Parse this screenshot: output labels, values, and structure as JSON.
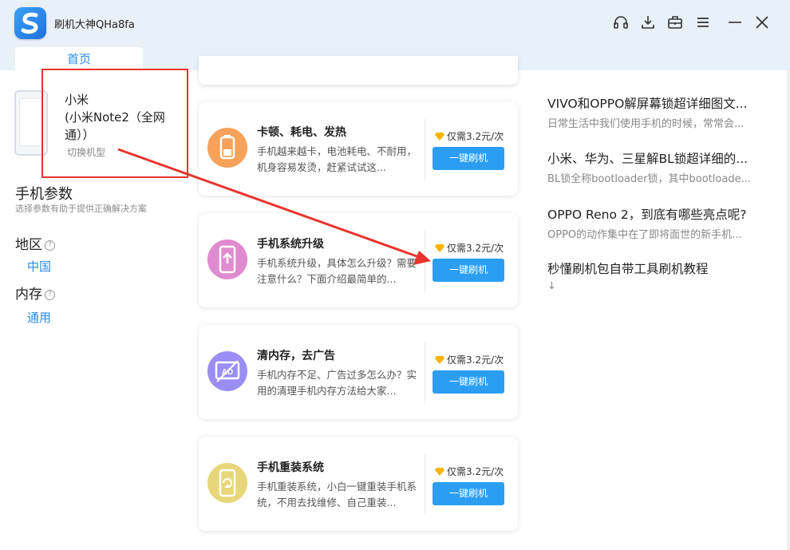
{
  "app": {
    "title": "刷机大神QHa8fa",
    "tab_home": "首页"
  },
  "device": {
    "brand": "小米",
    "model": "(小米Note2（全网通））",
    "switch_label": "切换机型"
  },
  "params": {
    "title": "手机参数",
    "subtitle": "选择参数有助于提供正确解决方案",
    "region_label": "地区",
    "region_value": "中国",
    "memory_label": "内存",
    "memory_value": "通用",
    "help_glyph": "?"
  },
  "cards": [
    {
      "title": "卡顿、耗电、发热",
      "desc": "手机越来越卡，电池耗电、不耐用，机身容易发烫，赶紧试试这...",
      "price": "仅需3.2元/次",
      "button": "一键刷机",
      "icon": "battery-icon",
      "color": "#f7a25a"
    },
    {
      "title": "手机系统升级",
      "desc": "手机系统升级，具体怎么升级？需要注意什么？下面介绍最简单的...",
      "price": "仅需3.2元/次",
      "button": "一键刷机",
      "icon": "phone-upgrade-icon",
      "color": "#e08bd0"
    },
    {
      "title": "清内存，去广告",
      "desc": "手机内存不足、广告过多怎么办？实用的清理手机内存方法给大家...",
      "price": "仅需3.2元/次",
      "button": "一键刷机",
      "icon": "ad-block-icon",
      "color": "#9a8ef5"
    },
    {
      "title": "手机重装系统",
      "desc": "手机重装系统，小白一键重装手机系统，不用去找维修、自己重装...",
      "price": "仅需3.2元/次",
      "button": "一键刷机",
      "icon": "phone-reinstall-icon",
      "color": "#e8d77a"
    }
  ],
  "articles": [
    {
      "title": "VIVO和OPPO解屏幕锁超详细图文...",
      "summary": "日常生活中我们使用手机的时候，常常会..."
    },
    {
      "title": "小米、华为、三星解BL锁超详细的...",
      "summary": "BL锁全称bootloader锁，其中bootloade..."
    },
    {
      "title": "OPPO Reno 2，到底有哪些亮点呢?",
      "summary": "OPPO的动作集中在了即将面世的新手机..."
    },
    {
      "title": "秒懂刷机包自带工具刷机教程",
      "summary": "↓"
    }
  ],
  "colors": {
    "accent": "#2b9ef2",
    "annotation": "#e8342e"
  }
}
